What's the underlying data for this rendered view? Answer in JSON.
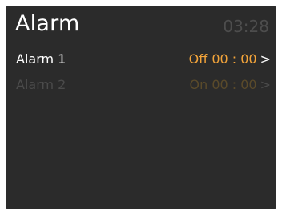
{
  "header": {
    "title": "Alarm",
    "clock": "03:28"
  },
  "alarms": [
    {
      "label": "Alarm 1",
      "state": "Off",
      "time": "00 : 00",
      "chevron": ">",
      "active": true
    },
    {
      "label": "Alarm 2",
      "state": "On",
      "time": "00 : 00",
      "chevron": ">",
      "active": false
    }
  ],
  "colors": {
    "background": "#2b2b2b",
    "accent": "#f3a43a",
    "text": "#ffffff",
    "dimmed": "#4b4b4b"
  }
}
